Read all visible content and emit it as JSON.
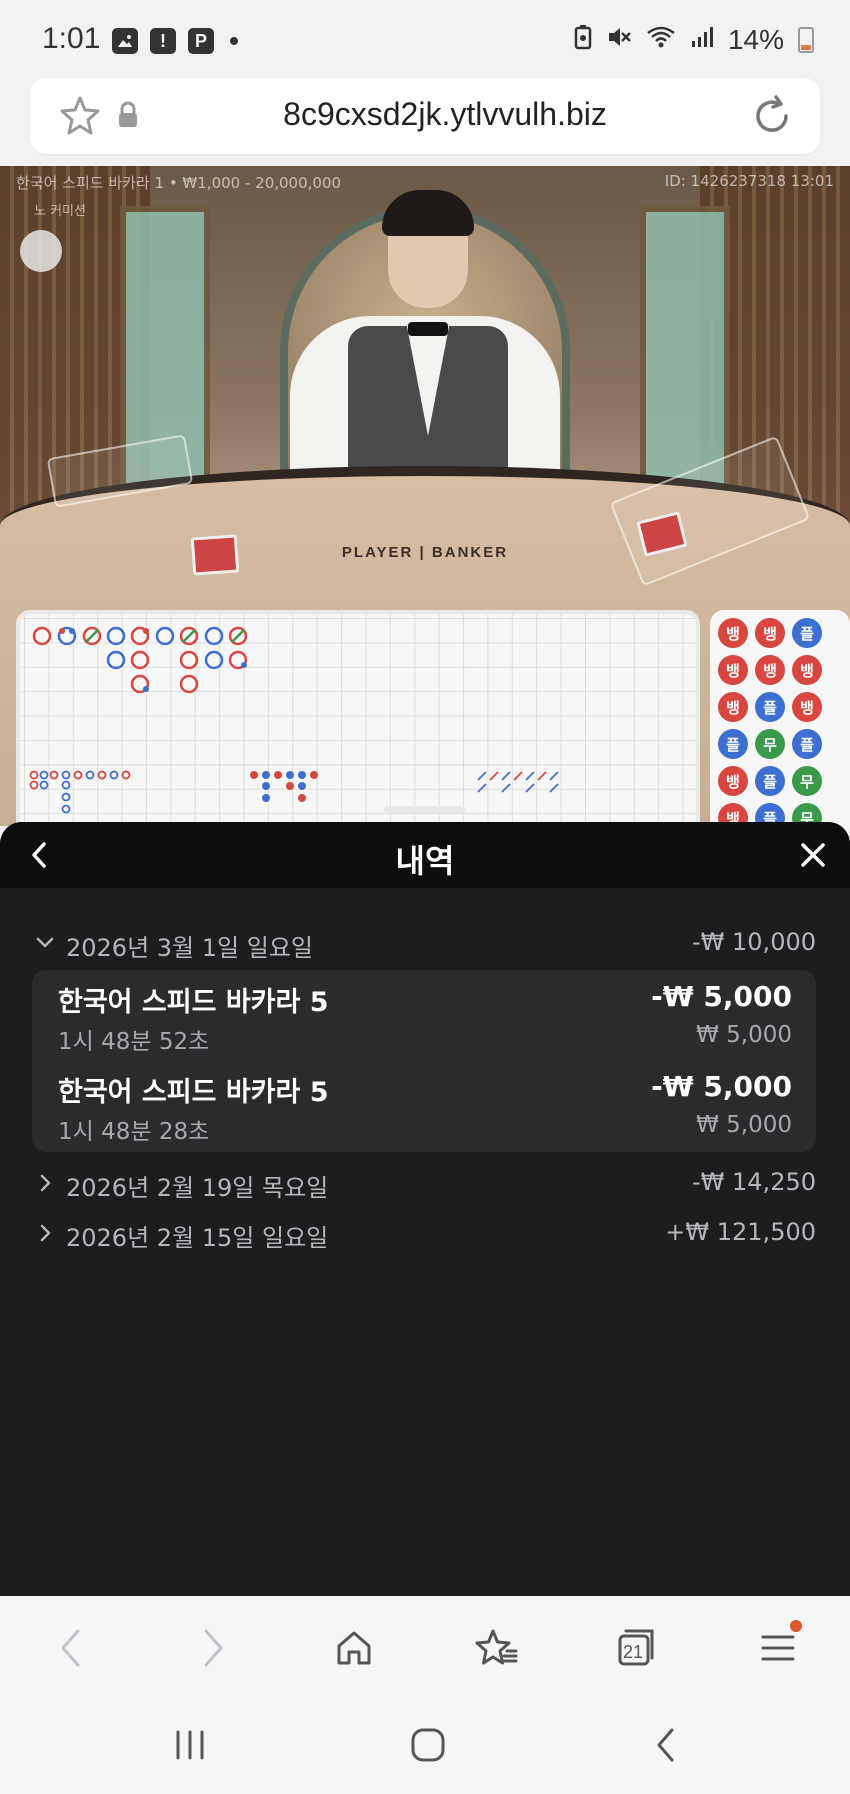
{
  "status_bar": {
    "time": "1:01",
    "left_icons": [
      "image-icon",
      "alert-icon",
      "parking-icon"
    ],
    "battery_percent": "14%",
    "right_icons": [
      "battery-saver-icon",
      "mute-icon",
      "wifi-icon",
      "signal-icon"
    ]
  },
  "url_bar": {
    "url": "8c9cxsd2jk.ytlvvulh.biz"
  },
  "video": {
    "info_left": "한국어 스피드 바카라 1 • ₩1,000 - 20,000,000",
    "info_right": "ID: 1426237318 13:01",
    "info_sub": "노 커미션",
    "table_text": "PLAYER | BANKER"
  },
  "bead_road": {
    "cells": [
      "뱅",
      "뱅",
      "뱅",
      "플",
      "뱅",
      "뱅",
      "뱅",
      "뱅",
      "플",
      "무",
      "플",
      "플",
      "플",
      "뱅",
      "뱅",
      "플",
      "무",
      "무"
    ]
  },
  "history": {
    "title": "내역",
    "days": [
      {
        "date": "2026년 3월 1일 일요일",
        "total": "-₩ 10,000",
        "expanded": true,
        "bets": [
          {
            "game": "한국어 스피드 바카라 5",
            "time": "1시 48분 52초",
            "result": "-₩ 5,000",
            "stake": "₩ 5,000"
          },
          {
            "game": "한국어 스피드 바카라 5",
            "time": "1시 48분 28초",
            "result": "-₩ 5,000",
            "stake": "₩ 5,000"
          }
        ]
      },
      {
        "date": "2026년 2월 19일 목요일",
        "total": "-₩ 14,250",
        "expanded": false
      },
      {
        "date": "2026년 2월 15일 일요일",
        "total": "+₩ 121,500",
        "expanded": false
      }
    ]
  },
  "browser_toolbar": {
    "tabs_count": "21"
  },
  "colors": {
    "banker_red": "#d9453f",
    "player_blue": "#3c6fd1",
    "tie_green": "#3a9a4a",
    "sheet_bg": "#1d1c1e",
    "notification_dot": "#e0552e"
  }
}
